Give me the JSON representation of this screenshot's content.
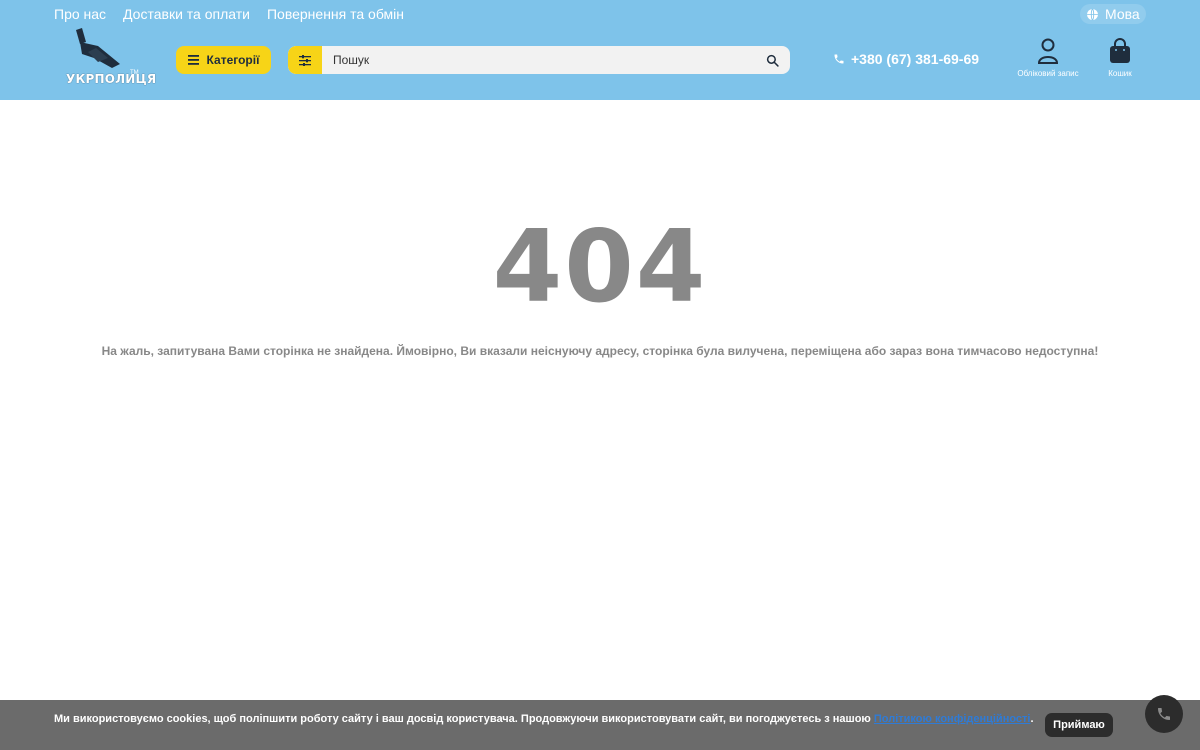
{
  "topnav": {
    "items": [
      "Про нас",
      "Доставки та оплати",
      "Повернення та обмін"
    ]
  },
  "lang": {
    "label": "Мова",
    "icon": "globe-icon"
  },
  "logo": {
    "text": "УКРПОЛИЦЯ",
    "tm": "TM"
  },
  "header": {
    "categories_label": "Категорії",
    "search_placeholder": "Пошук",
    "phone": "+380 (67) 381-69-69",
    "account_label": "Обліковий запис",
    "cart_label": "Кошик"
  },
  "error": {
    "code": "404",
    "message": "На жаль, запитувана Вами сторінка не знайдена. Ймовірно, Ви вказали неіснуючу адресу, сторінка була вилучена, переміщена або зараз вона тимчасово недоступна!"
  },
  "cookie": {
    "text": "Ми використовуємо cookies, щоб поліпшити роботу сайту і ваш досвід користувача. Продовжуючи використовувати сайт, ви погоджуєтесь з нашою ",
    "link": "Політикою конфіденційності",
    "suffix": ".",
    "accept": "Приймаю"
  },
  "colors": {
    "header_bg": "#7ec3ea",
    "accent_yellow": "#f7d417",
    "muted_text": "#888888",
    "cookie_bg": "#6b6b6b"
  }
}
